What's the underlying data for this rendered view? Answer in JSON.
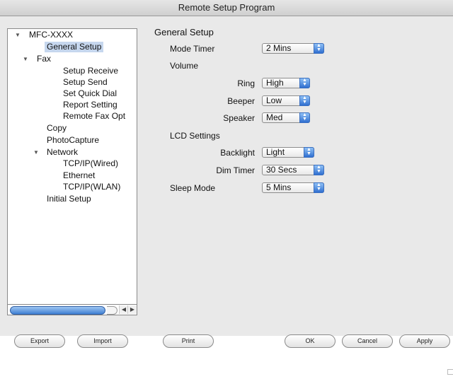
{
  "window": {
    "title": "Remote Setup Program"
  },
  "tree": {
    "items": [
      {
        "label": "MFC-XXXX"
      },
      {
        "label": "General Setup"
      },
      {
        "label": "Fax"
      },
      {
        "label": "Setup Receive"
      },
      {
        "label": "Setup Send"
      },
      {
        "label": "Set Quick Dial"
      },
      {
        "label": "Report Setting"
      },
      {
        "label": "Remote Fax Opt"
      },
      {
        "label": "Copy"
      },
      {
        "label": "PhotoCapture"
      },
      {
        "label": "Network"
      },
      {
        "label": "TCP/IP(Wired)"
      },
      {
        "label": "Ethernet"
      },
      {
        "label": "TCP/IP(WLAN)"
      },
      {
        "label": "Initial Setup"
      }
    ],
    "selected": "General Setup"
  },
  "panel": {
    "title": "General Setup",
    "mode_timer": {
      "label": "Mode Timer",
      "value": "2 Mins"
    },
    "volume": {
      "heading": "Volume",
      "ring": {
        "label": "Ring",
        "value": "High"
      },
      "beeper": {
        "label": "Beeper",
        "value": "Low"
      },
      "speaker": {
        "label": "Speaker",
        "value": "Med"
      }
    },
    "lcd": {
      "heading": "LCD Settings",
      "backlight": {
        "label": "Backlight",
        "value": "Light"
      },
      "dim_timer": {
        "label": "Dim Timer",
        "value": "30 Secs"
      }
    },
    "sleep_mode": {
      "label": "Sleep Mode",
      "value": "5 Mins"
    }
  },
  "buttons": {
    "export": "Export",
    "import": "Import",
    "print": "Print",
    "ok": "OK",
    "cancel": "Cancel",
    "apply": "Apply"
  },
  "icons": {
    "disclosure_open": "triangle-down-icon",
    "scroll_left": "arrow-left-icon",
    "scroll_right": "arrow-right-icon",
    "select_stepper": "updown-arrows-icon"
  }
}
